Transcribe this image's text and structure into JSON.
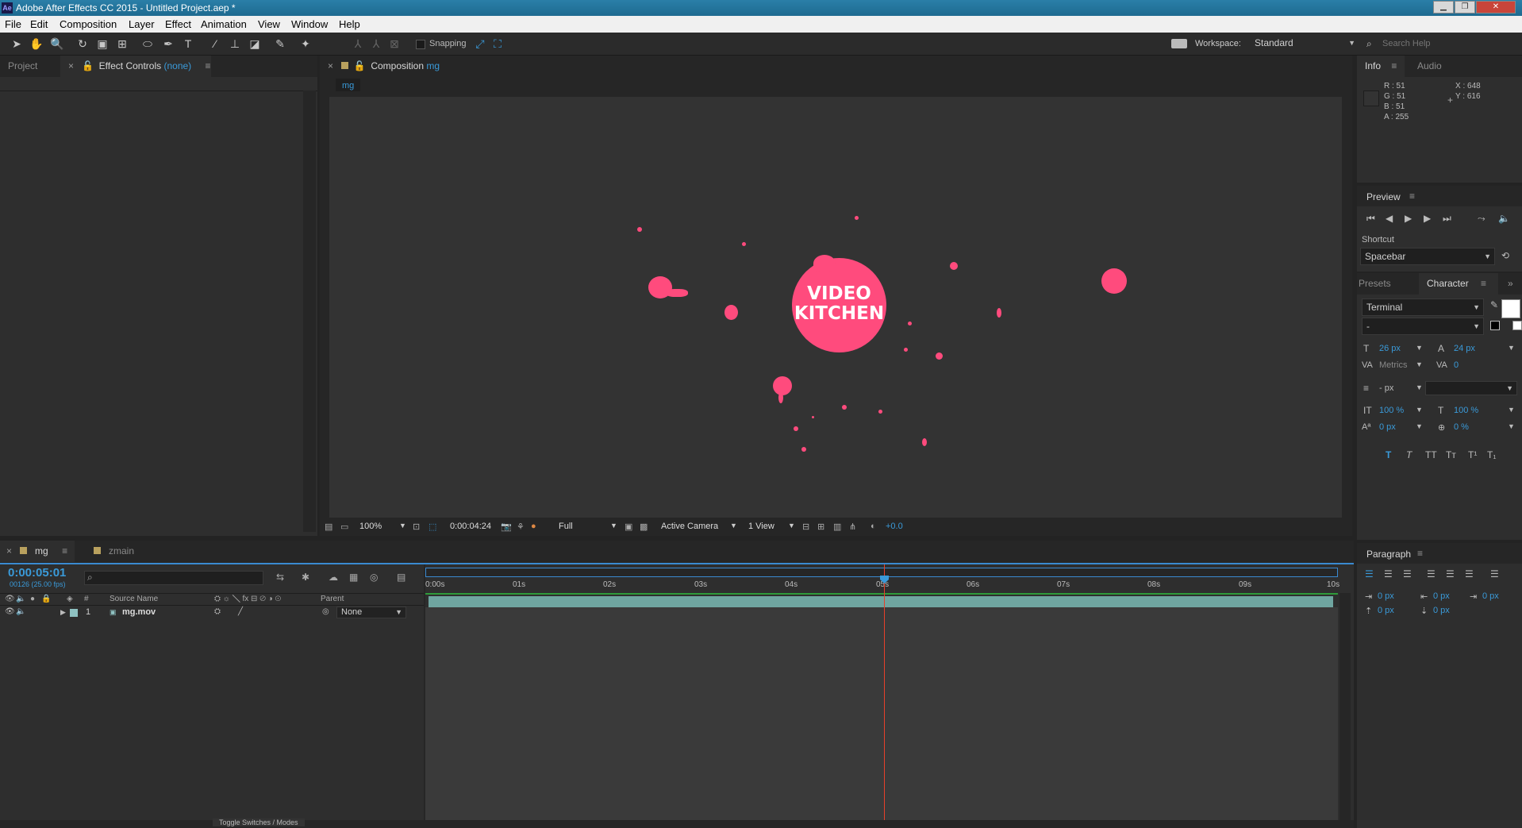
{
  "window": {
    "title": "Adobe After Effects CC 2015 - Untitled Project.aep *",
    "logo": "Ae"
  },
  "menu": [
    "File",
    "Edit",
    "Composition",
    "Layer",
    "Effect",
    "Animation",
    "View",
    "Window",
    "Help"
  ],
  "toolbar": {
    "snapping_label": "Snapping",
    "workspace_label": "Workspace:",
    "workspace_value": "Standard",
    "search_placeholder": "Search Help"
  },
  "left_panel": {
    "tab_project": "Project",
    "tab_effect_controls": "Effect Controls",
    "effect_controls_target": "(none)"
  },
  "composition": {
    "tab_label": "Composition",
    "tab_name": "mg",
    "breadcrumb": "mg",
    "logo_line1": "VIDEO",
    "logo_line2": "KITCHEN",
    "accent_color": "#ff4b7d",
    "footer": {
      "zoom": "100%",
      "timecode": "0:00:04:24",
      "resolution": "Full",
      "camera": "Active Camera",
      "views": "1 View",
      "exposure": "+0.0"
    }
  },
  "info_panel": {
    "tab_info": "Info",
    "tab_audio": "Audio",
    "r": "R : 51",
    "g": "G : 51",
    "b": "B : 51",
    "a": "A : 255",
    "x": "X : 648",
    "y": "Y : 616"
  },
  "preview_panel": {
    "title": "Preview",
    "shortcut_label": "Shortcut",
    "shortcut_value": "Spacebar"
  },
  "character_panel": {
    "tab_presets": "Presets",
    "tab_character": "Character",
    "font": "Terminal",
    "style": "-",
    "font_size": "26 px",
    "leading": "24 px",
    "kerning": "Metrics",
    "tracking": "0",
    "stroke": "- px",
    "vscale": "100 %",
    "hscale": "100 %",
    "baseline": "0 px",
    "tsume": "0 %"
  },
  "paragraph_panel": {
    "title": "Paragraph",
    "indent_left": "0 px",
    "indent_right": "0 px",
    "indent_first": "0 px",
    "space_before": "0 px",
    "space_after": "0 px"
  },
  "timeline": {
    "tab_active": "mg",
    "tab_other": "zmain",
    "timecode": "0:00:05:01",
    "frame_info": "00126 (25.00 fps)",
    "columns": {
      "number": "#",
      "source_name": "Source Name",
      "parent": "Parent"
    },
    "ruler": [
      "0:00s",
      "01s",
      "02s",
      "03s",
      "04s",
      "05s",
      "06s",
      "07s",
      "08s",
      "09s",
      "10s"
    ],
    "layers": [
      {
        "index": "1",
        "name": "mg.mov",
        "parent": "None"
      }
    ],
    "footer_toggle": "Toggle Switches / Modes"
  }
}
